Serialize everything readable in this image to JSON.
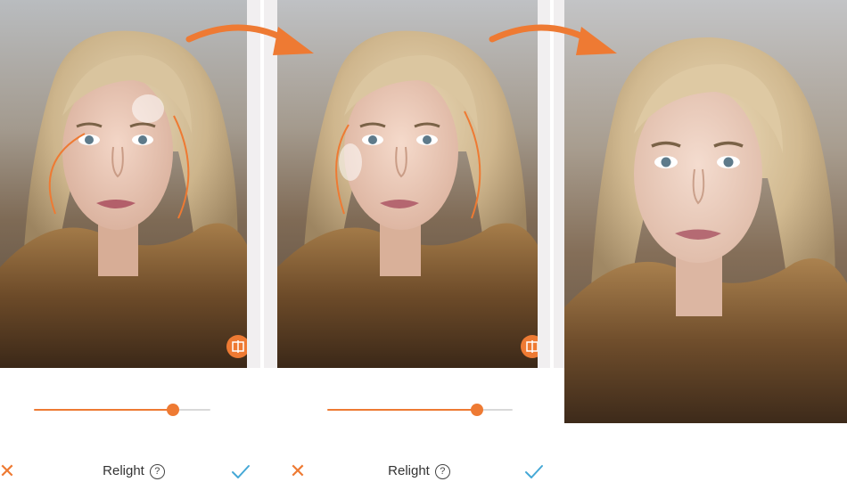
{
  "panels": [
    {
      "toolbar": {
        "cancel_glyph": "✕",
        "title": "Relight",
        "help_glyph": "?",
        "confirm_icon": "checkmark-icon"
      },
      "slider": {
        "value": 0.79
      },
      "compare_icon": "compare-split-icon"
    },
    {
      "toolbar": {
        "cancel_glyph": "✕",
        "title": "Relight",
        "help_glyph": "?",
        "confirm_icon": "checkmark-icon"
      },
      "slider": {
        "value": 0.81
      },
      "compare_icon": "compare-split-icon"
    }
  ],
  "colors": {
    "accent": "#ee7a33",
    "slider_rest": "#d9d9d9",
    "confirm": "#45a8d6"
  }
}
